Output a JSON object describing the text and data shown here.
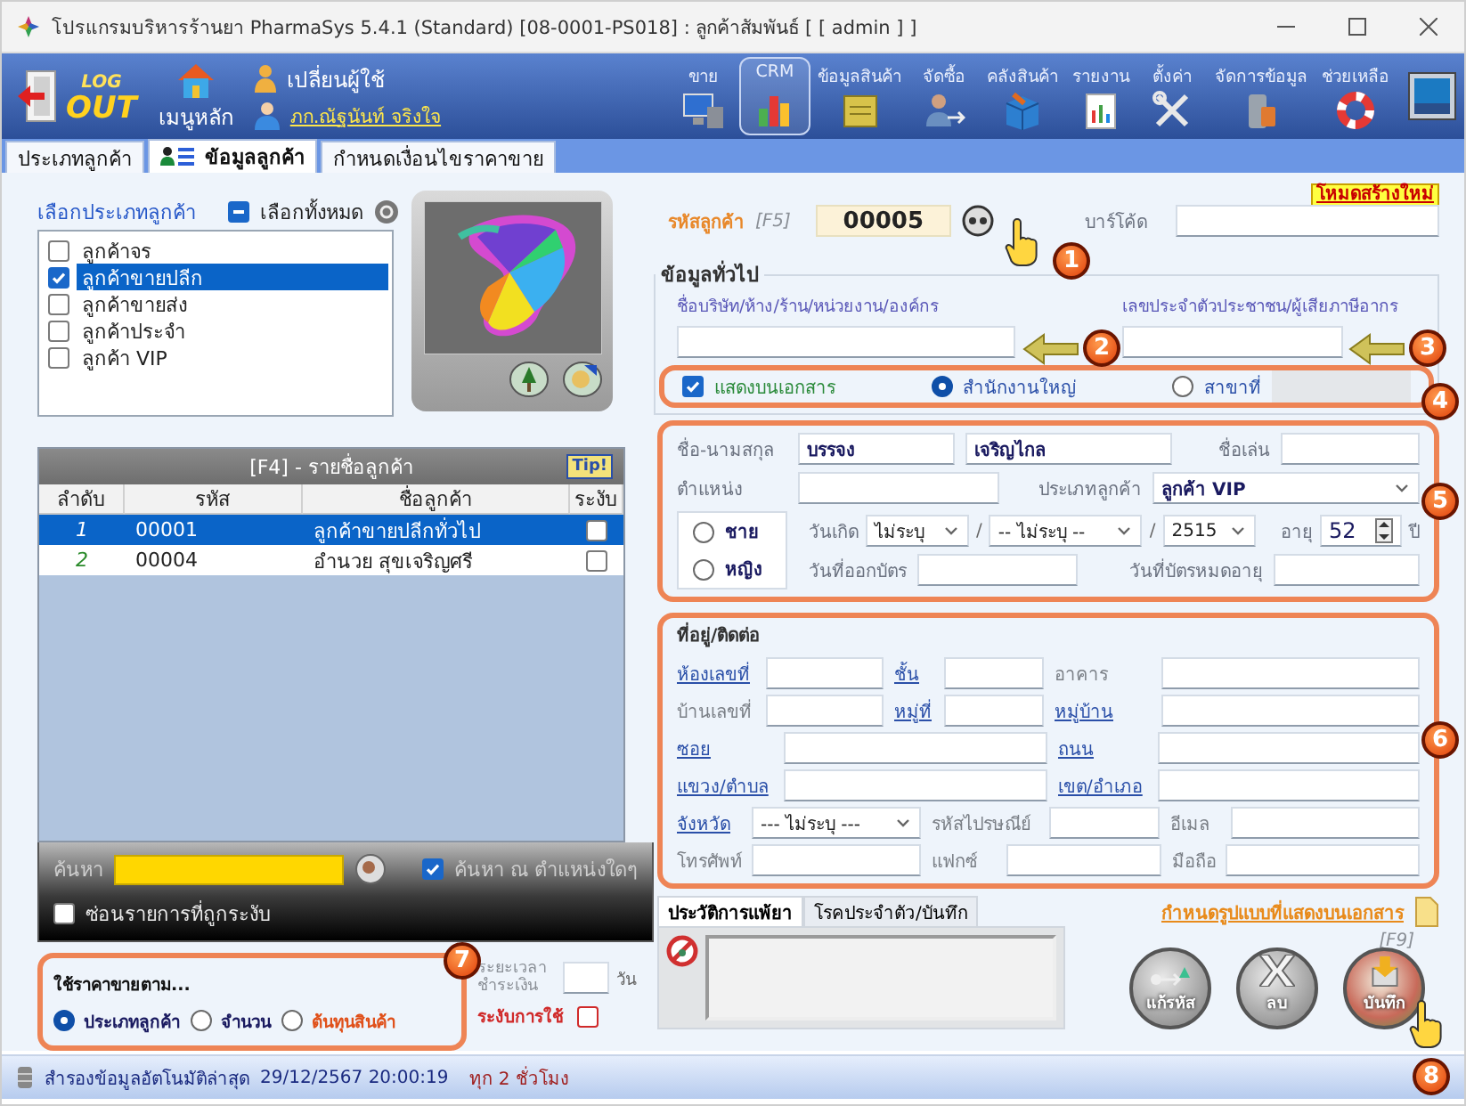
{
  "window": {
    "title": "โปรแกรมบริหารร้านยา PharmaSys 5.4.1 (Standard) [08-0001-PS018] : ลูกค้าสัมพันธ์ [ [ admin ] ]"
  },
  "toolbar": {
    "logout": {
      "top": "LOG",
      "bottom": "OUT"
    },
    "home": "เมนูหลัก",
    "switch_user": "เปลี่ยนผู้ใช้",
    "user_name": "ภก.ณัฐนันท์ จริงใจ",
    "buttons": [
      {
        "label": "ขาย",
        "kind": "sale",
        "selected": false
      },
      {
        "label": "CRM",
        "kind": "crm",
        "selected": true
      },
      {
        "label": "ข้อมูลสินค้า",
        "kind": "product",
        "selected": false
      },
      {
        "label": "จัดซื้อ",
        "kind": "purchase",
        "selected": false
      },
      {
        "label": "คลังสินค้า",
        "kind": "stock",
        "selected": false
      },
      {
        "label": "รายงาน",
        "kind": "report",
        "selected": false
      },
      {
        "label": "ตั้งค่า",
        "kind": "settings",
        "selected": false
      },
      {
        "label": "จัดการข้อมูล",
        "kind": "data",
        "selected": false
      },
      {
        "label": "ช่วยเหลือ",
        "kind": "help",
        "selected": false
      }
    ]
  },
  "tabs": [
    {
      "label": "ประเภทลูกค้า",
      "selected": false
    },
    {
      "label": "ข้อมูลลูกค้า",
      "selected": true
    },
    {
      "label": "กำหนดเงื่อนไขราคาขาย",
      "selected": false
    }
  ],
  "customer_types": {
    "title": "เลือกประเภทลูกค้า",
    "select_all": {
      "label": "เลือกทั้งหมด",
      "partial": true
    },
    "items": [
      {
        "label": "ลูกค้าจร",
        "checked": false,
        "selected": false
      },
      {
        "label": "ลูกค้าขายปลีก",
        "checked": true,
        "selected": true
      },
      {
        "label": "ลูกค้าขายส่ง",
        "checked": false,
        "selected": false
      },
      {
        "label": "ลูกค้าประจำ",
        "checked": false,
        "selected": false
      },
      {
        "label": "ลูกค้า VIP",
        "checked": false,
        "selected": false
      }
    ]
  },
  "customer_list": {
    "title": "[F4] - รายชื่อลูกค้า",
    "tip": "Tip!",
    "columns": [
      "ลำดับ",
      "รหัส",
      "ชื่อลูกค้า",
      "ระงับ"
    ],
    "rows": [
      {
        "index": "1",
        "code": "00001",
        "name": "ลูกค้าขายปลีกทั่วไป",
        "suspended": false,
        "selected": true
      },
      {
        "index": "2",
        "code": "00004",
        "name": "อำนวย สุขเจริญศรี",
        "suspended": false,
        "selected": false
      }
    ]
  },
  "search": {
    "label": "ค้นหา",
    "anywhere": {
      "label": "ค้นหา ณ ตำแหน่งใดๆ",
      "checked": true
    },
    "hide_suspended": {
      "label": "ซ่อนรายการที่ถูกระงับ",
      "checked": false
    }
  },
  "price_by": {
    "title": "ใช้ราคาขายตาม...",
    "options": [
      {
        "label": "ประเภทลูกค้า",
        "selected": true,
        "color": "#1a1a60"
      },
      {
        "label": "จำนวน",
        "selected": false,
        "color": "#1a1a60"
      },
      {
        "label": "ต้นทุนสินค้า",
        "selected": false,
        "color": "#e0501a"
      }
    ]
  },
  "payment": {
    "label": "ระยะเวลา ชำระเงิน",
    "unit": "วัน"
  },
  "suspend": {
    "label": "ระงับการใช้",
    "checked": false
  },
  "form": {
    "mode": "โหมดสร้างใหม่",
    "customer_code": {
      "label": "รหัสลูกค้า",
      "shortcut": "[F5]",
      "value": "00005"
    },
    "barcode_label": "บาร์โค้ด",
    "general": {
      "title": "ข้อมูลทั่วไป",
      "company_label": "ชื่อบริษัท/ห้าง/ร้าน/หน่วยงาน/องค์กร",
      "tax_id_label": "เลขประจำตัวประชาชน/ผู้เสียภาษีอากร",
      "show_on_document": {
        "label": "แสดงบนเอกสาร",
        "checked": true
      },
      "office": [
        {
          "label": "สำนักงานใหญ่",
          "selected": true
        },
        {
          "label": "สาขาที่",
          "selected": false
        }
      ]
    },
    "person": {
      "name_label": "ชื่อ-นามสกุล",
      "first_name": "บรรจง",
      "last_name": "เจริญไกล",
      "nickname_label": "ชื่อเล่น",
      "position_label": "ตำแหน่ง",
      "type_label": "ประเภทลูกค้า",
      "type_value": "ลูกค้า VIP",
      "genders": [
        {
          "label": "ชาย",
          "selected": false
        },
        {
          "label": "หญิง",
          "selected": false
        }
      ],
      "birth_label": "วันเกิด",
      "birth_day": "ไม่ระบุ",
      "birth_month": "-- ไม่ระบุ --",
      "birth_year": "2515",
      "separators": [
        "/",
        "/"
      ],
      "age_label": "อายุ",
      "age": "52",
      "age_unit": "ปี",
      "issue_label": "วันที่ออกบัตร",
      "expiry_label": "วันที่บัตรหมดอายุ"
    },
    "address": {
      "title": "ที่อยู่/ติดต่อ",
      "rows": [
        {
          "fields": [
            {
              "label": "ห้องเลขที่",
              "link": true,
              "kind": "text"
            },
            {
              "label": "ชั้น",
              "link": true,
              "kind": "text"
            },
            {
              "label": "อาคาร",
              "link": false,
              "kind": "text"
            }
          ]
        },
        {
          "fields": [
            {
              "label": "บ้านเลขที่",
              "link": false,
              "kind": "text"
            },
            {
              "label": "หมู่ที่",
              "link": true,
              "kind": "text"
            },
            {
              "label": "หมู่บ้าน",
              "link": true,
              "kind": "text"
            }
          ]
        },
        {
          "fields": [
            {
              "label": "ซอย",
              "link": true,
              "kind": "text"
            },
            {
              "label": "ถนน",
              "link": true,
              "kind": "text"
            }
          ]
        },
        {
          "fields": [
            {
              "label": "แขวง/ตำบล",
              "link": true,
              "kind": "text"
            },
            {
              "label": "เขต/อำเภอ",
              "link": true,
              "kind": "text"
            }
          ]
        },
        {
          "fields": [
            {
              "label": "จังหวัด",
              "link": true,
              "kind": "select",
              "value": "--- ไม่ระบุ ---"
            },
            {
              "label": "รหัสไปรษณีย์",
              "link": false,
              "kind": "text"
            },
            {
              "label": "อีเมล",
              "link": false,
              "kind": "text"
            }
          ]
        },
        {
          "fields": [
            {
              "label": "โทรศัพท์",
              "link": false,
              "kind": "text"
            },
            {
              "label": "แฟกซ์",
              "link": false,
              "kind": "text"
            },
            {
              "label": "มือถือ",
              "link": false,
              "kind": "text"
            }
          ]
        }
      ]
    },
    "note_tabs": [
      {
        "label": "ประวัติการแพ้ยา",
        "selected": true
      },
      {
        "label": "โรคประจำตัว/บันทึก",
        "selected": false
      }
    ],
    "document_format_link": "กำหนดรูปแบบที่แสดงบนเอกสาร",
    "save_shortcut": "[F9]",
    "actions": [
      {
        "label": "แก้รหัส",
        "kind": "recode"
      },
      {
        "label": "ลบ",
        "kind": "delete"
      },
      {
        "label": "บันทึก",
        "kind": "save"
      }
    ]
  },
  "status_bar": {
    "backup_label": "สำรองข้อมูลอัตโนมัติล่าสุด",
    "backup_time": "29/12/2567 20:00:19",
    "interval": "ทุก 2 ชั่วโมง"
  },
  "annotations": [
    "1",
    "2",
    "3",
    "4",
    "5",
    "6",
    "7",
    "8"
  ]
}
